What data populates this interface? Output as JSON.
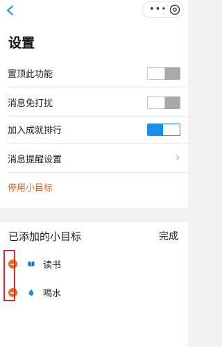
{
  "header": {
    "back_icon": "chevron-left-icon",
    "more_label": "•••",
    "target_icon": "target-icon"
  },
  "page_title": "设置",
  "settings": [
    {
      "label": "置顶此功能",
      "type": "toggle",
      "on": false
    },
    {
      "label": "消息免打扰",
      "type": "toggle",
      "on": false
    },
    {
      "label": "加入成就排行",
      "type": "toggle",
      "on": true
    },
    {
      "label": "消息提醒设置",
      "type": "link"
    },
    {
      "label": "停用小目标",
      "type": "action",
      "color": "#e0672b"
    }
  ],
  "goals_section": {
    "title": "已添加的小目标",
    "done_label": "完成",
    "items": [
      {
        "label": "读书",
        "icon": "book-icon",
        "icon_color": "#1a6fd8"
      },
      {
        "label": "喝水",
        "icon": "water-drop-icon",
        "icon_color": "#1a8fe8"
      }
    ]
  },
  "colors": {
    "accent_blue": "#1a8fe8",
    "remove_orange": "#e76b22",
    "highlight_red": "#e3262b"
  }
}
